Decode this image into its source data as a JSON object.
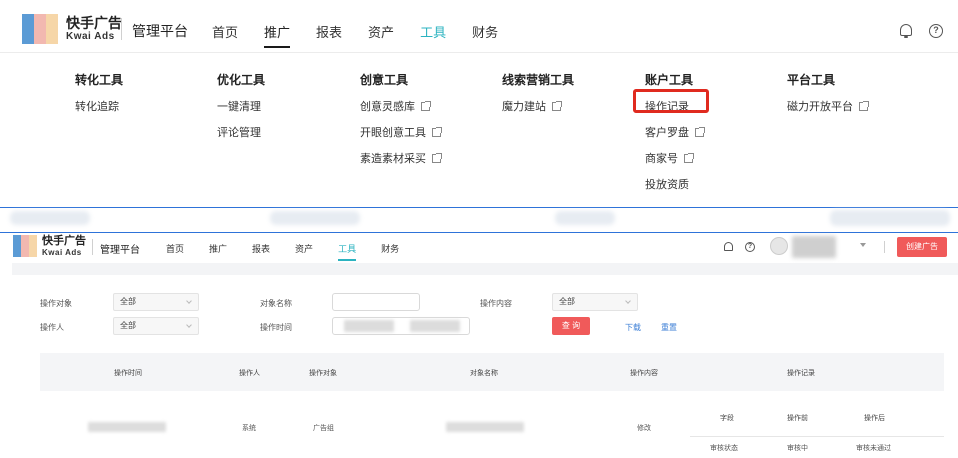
{
  "brand": {
    "name_cn": "快手广告",
    "name_en": "Kwai Ads",
    "platform": "管理平台",
    "colors": [
      "#5b9bd5",
      "#f2b8b0",
      "#f6d6a8"
    ]
  },
  "nav": {
    "items": [
      "首页",
      "推广",
      "报表",
      "资产",
      "工具",
      "财务"
    ],
    "active_main": "推广",
    "active_tool": "工具"
  },
  "header_icons": {
    "bell": "bell-icon",
    "help": "help-circle-icon",
    "help_glyph": "?"
  },
  "mega_menu": {
    "columns": [
      {
        "title": "转化工具",
        "items": [
          {
            "label": "转化追踪",
            "external": false
          }
        ]
      },
      {
        "title": "优化工具",
        "items": [
          {
            "label": "一键清理",
            "external": false
          },
          {
            "label": "评论管理",
            "external": false
          }
        ]
      },
      {
        "title": "创意工具",
        "items": [
          {
            "label": "创意灵感库",
            "external": true
          },
          {
            "label": "开眼创意工具",
            "external": true
          },
          {
            "label": "素造素材采买",
            "external": true
          }
        ]
      },
      {
        "title": "线索营销工具",
        "items": [
          {
            "label": "魔力建站",
            "external": true
          }
        ]
      },
      {
        "title": "账户工具",
        "items": [
          {
            "label": "操作记录",
            "external": false,
            "highlighted": true
          },
          {
            "label": "客户罗盘",
            "external": true
          },
          {
            "label": "商家号",
            "external": true
          },
          {
            "label": "投放资质",
            "external": false
          }
        ]
      },
      {
        "title": "平台工具",
        "items": [
          {
            "label": "磁力开放平台",
            "external": true
          }
        ]
      }
    ],
    "highlight_color": "#e02a1f"
  },
  "page_header": {
    "nav": [
      "首页",
      "推广",
      "报表",
      "资产",
      "工具",
      "财务"
    ],
    "active": "工具",
    "create_button": "创建广告",
    "accent_color": "#f05a5a",
    "tool_color": "#2bb3c0"
  },
  "filters": {
    "op_object": {
      "label": "操作对象",
      "value": "全部"
    },
    "object_name": {
      "label": "对象名称",
      "value": ""
    },
    "op_content": {
      "label": "操作内容",
      "value": "全部"
    },
    "operator": {
      "label": "操作人",
      "value": "全部"
    },
    "op_time": {
      "label": "操作时间"
    },
    "query_button": "查 询",
    "download": "下载",
    "reset": "重置"
  },
  "table": {
    "headers": [
      "操作时间",
      "操作人",
      "操作对象",
      "对象名称",
      "操作内容",
      "操作记录"
    ],
    "sub_headers": [
      "字段",
      "操作前",
      "操作后"
    ],
    "rows": [
      {
        "operator": "系统",
        "object": "广告组",
        "content": "修改",
        "field": "审核状态",
        "before": "审核中",
        "after": "审核未通过"
      }
    ]
  }
}
